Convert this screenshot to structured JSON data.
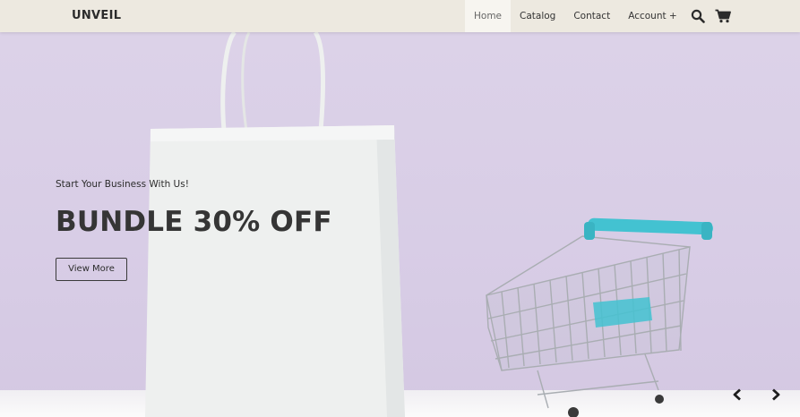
{
  "brand": {
    "name": "UNVEIL"
  },
  "nav": {
    "links": [
      {
        "label": "Home",
        "active": true
      },
      {
        "label": "Catalog",
        "active": false
      },
      {
        "label": "Contact",
        "active": false
      },
      {
        "label": "Account +",
        "active": false
      }
    ],
    "icons": [
      "search-icon",
      "cart-icon"
    ]
  },
  "hero": {
    "kicker": "Start Your Business With Us!",
    "title": "BUNDLE 30% OFF",
    "button_label": "View More",
    "background_color": "#dcd2e8",
    "accent_color": "#43c2d1"
  },
  "carousel": {
    "prev_icon": "chevron-left-icon",
    "next_icon": "chevron-right-icon"
  }
}
